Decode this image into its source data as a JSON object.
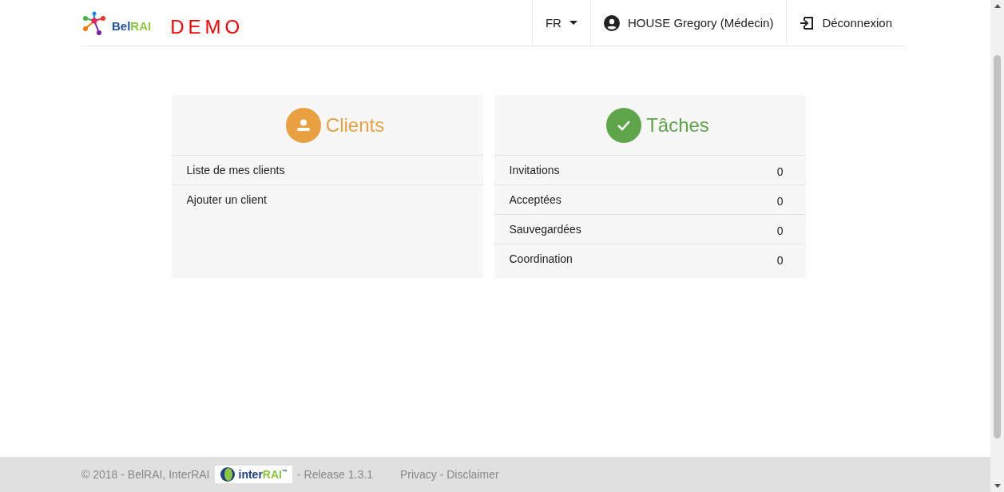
{
  "header": {
    "logo": {
      "part_1": "Bel",
      "part_2": "RAI"
    },
    "demo_label": "DEMO",
    "language": "FR",
    "user": "HOUSE Gregory (Médecin)",
    "logout": "Déconnexion"
  },
  "cards": [
    {
      "kind": "clients",
      "title": "Clients",
      "color": "#e8a040",
      "rows": [
        {
          "label": "Liste de mes clients"
        },
        {
          "label": "Ajouter un client"
        }
      ]
    },
    {
      "kind": "tasks",
      "title": "Tâches",
      "color": "#5da548",
      "rows": [
        {
          "label": "Invitations",
          "count": "0"
        },
        {
          "label": "Acceptées",
          "count": "0"
        },
        {
          "label": "Sauvegardées",
          "count": "0"
        },
        {
          "label": "Coordination",
          "count": "0"
        }
      ]
    }
  ],
  "footer": {
    "copyright": "© 2018 - BelRAI, InterRAI",
    "partner_logo": {
      "part_1": "inter",
      "part_2": "RAI",
      "mark": "™"
    },
    "release": "- Release 1.3.1",
    "links": "Privacy - Disclaimer"
  }
}
